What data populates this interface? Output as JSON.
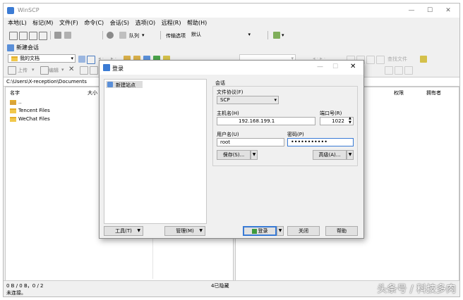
{
  "window": {
    "title": "WinSCP",
    "min": "—",
    "max": "☐",
    "close": "✕"
  },
  "menu": [
    "本地(L)",
    "标记(M)",
    "文件(F)",
    "命令(C)",
    "会话(S)",
    "选项(O)",
    "远程(R)",
    "帮助(H)"
  ],
  "toolbar": {
    "queue_label": "队列",
    "transfer_label": "传输选项",
    "transfer_value": "默认"
  },
  "session_tab": {
    "label": "新建会话"
  },
  "left": {
    "location": "我的文档",
    "upload": "上传",
    "edit": "编辑",
    "path": "C:\\Users\\X-reception\\Documents",
    "columns": [
      "名字",
      "大小"
    ],
    "files": [
      "..",
      "Tencent Files",
      "WeChat Files"
    ]
  },
  "right": {
    "find_files": "查找文件",
    "columns": [
      "权限",
      "拥有者"
    ]
  },
  "status": {
    "left_stats": "0 B / 0 B，0 / 2",
    "hidden": "4已隐藏",
    "connection": "未连接。"
  },
  "watermark": "头条号 / 科技多肉",
  "login": {
    "title": "登录",
    "site_tree": [
      "新建站点"
    ],
    "session_header": "会话",
    "protocol_label": "文件协议(F)",
    "protocol_value": "SCP",
    "host_label": "主机名(H)",
    "host_value": "192.168.199.1",
    "port_label": "端口号(R)",
    "port_value": "1022",
    "user_label": "用户名(U)",
    "user_value": "root",
    "password_label": "密码(P)",
    "password_value": "•••••••••••",
    "save_button": "保存(S)...",
    "advanced_button": "高级(A)...",
    "tools_button": "工具(T)",
    "manage_button": "管理(M)",
    "login_button": "登录",
    "close_button": "关闭",
    "help_button": "帮助"
  }
}
